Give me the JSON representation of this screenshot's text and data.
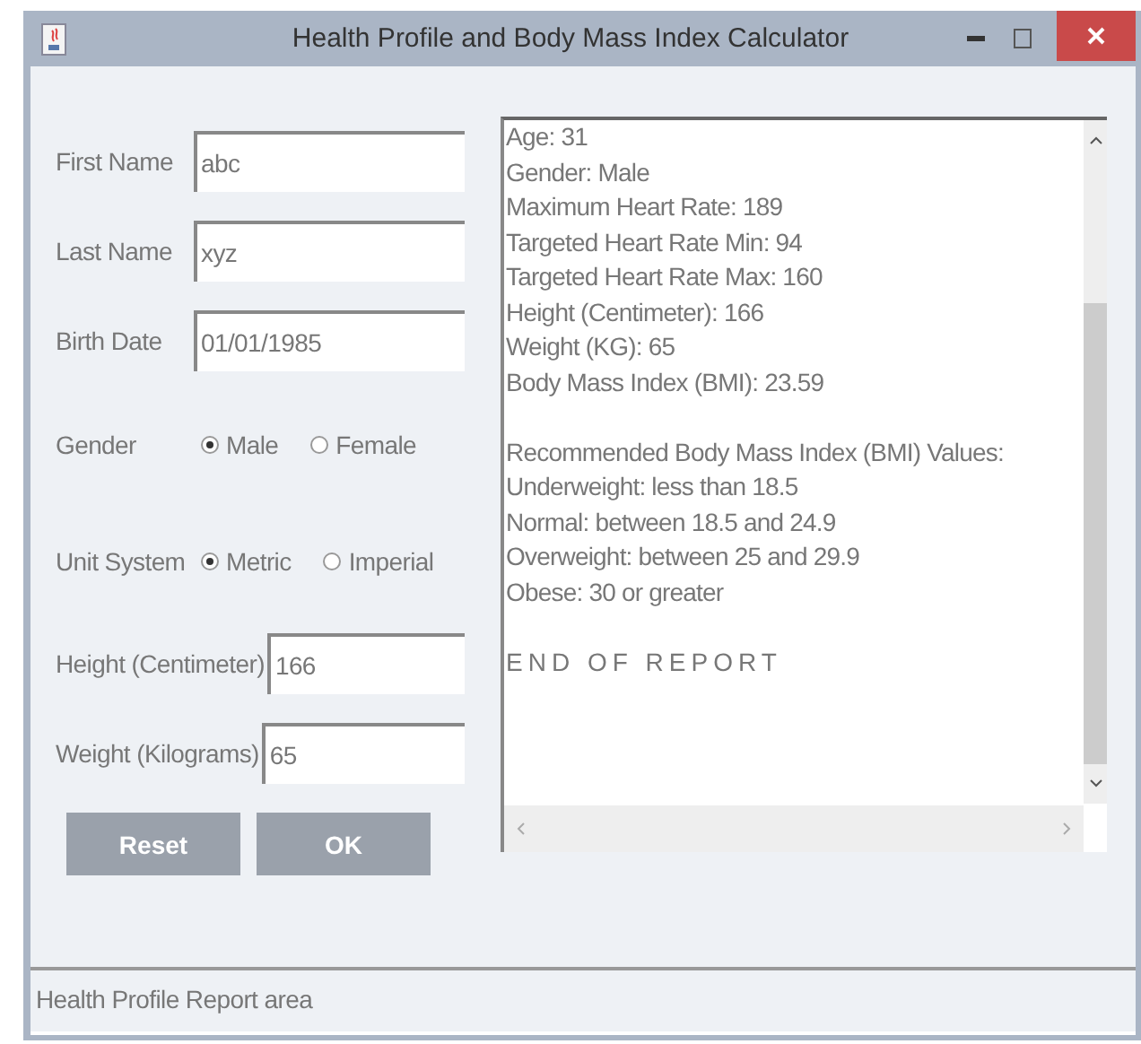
{
  "window": {
    "title": "Health Profile and Body Mass Index Calculator"
  },
  "form": {
    "fields": [
      {
        "label": "First Name",
        "value": "abc",
        "kind": "text"
      },
      {
        "label": "Last Name",
        "value": "xyz",
        "kind": "text"
      },
      {
        "label": "Birth Date",
        "value": "01/01/1985",
        "kind": "text"
      },
      {
        "label": "Gender",
        "kind": "radio",
        "options": [
          {
            "label": "Male",
            "selected": true
          },
          {
            "label": "Female",
            "selected": false
          }
        ]
      },
      {
        "label": "Unit System",
        "kind": "radio",
        "options": [
          {
            "label": "Metric",
            "selected": true
          },
          {
            "label": "Imperial",
            "selected": false
          }
        ]
      },
      {
        "label": "Height (Centimeter)",
        "value": "166",
        "kind": "measure"
      },
      {
        "label": "Weight (Kilograms)",
        "value": "65",
        "kind": "measure"
      }
    ],
    "buttons": [
      "Reset",
      "OK"
    ]
  },
  "report": {
    "sections": [
      {
        "kind": "lines",
        "lines": [
          "Age: 31",
          "Gender: Male",
          "Maximum Heart Rate: 189",
          "Targeted Heart Rate Min: 94",
          "Targeted Heart Rate Max: 160",
          "Height (Centimeter): 166",
          "Weight (KG): 65",
          "Body Mass Index (BMI): 23.59"
        ]
      },
      {
        "kind": "lines",
        "lines": [
          "Recommended Body Mass Index (BMI) Values:",
          "Underweight: less than 18.5",
          "Normal: between 18.5 and 24.9",
          "Overweight: between 25 and 29.9",
          "Obese: 30 or greater"
        ]
      },
      {
        "kind": "footer",
        "lines": [
          "END OF REPORT"
        ]
      }
    ]
  },
  "status_bar": {
    "text": "Health Profile Report area"
  }
}
